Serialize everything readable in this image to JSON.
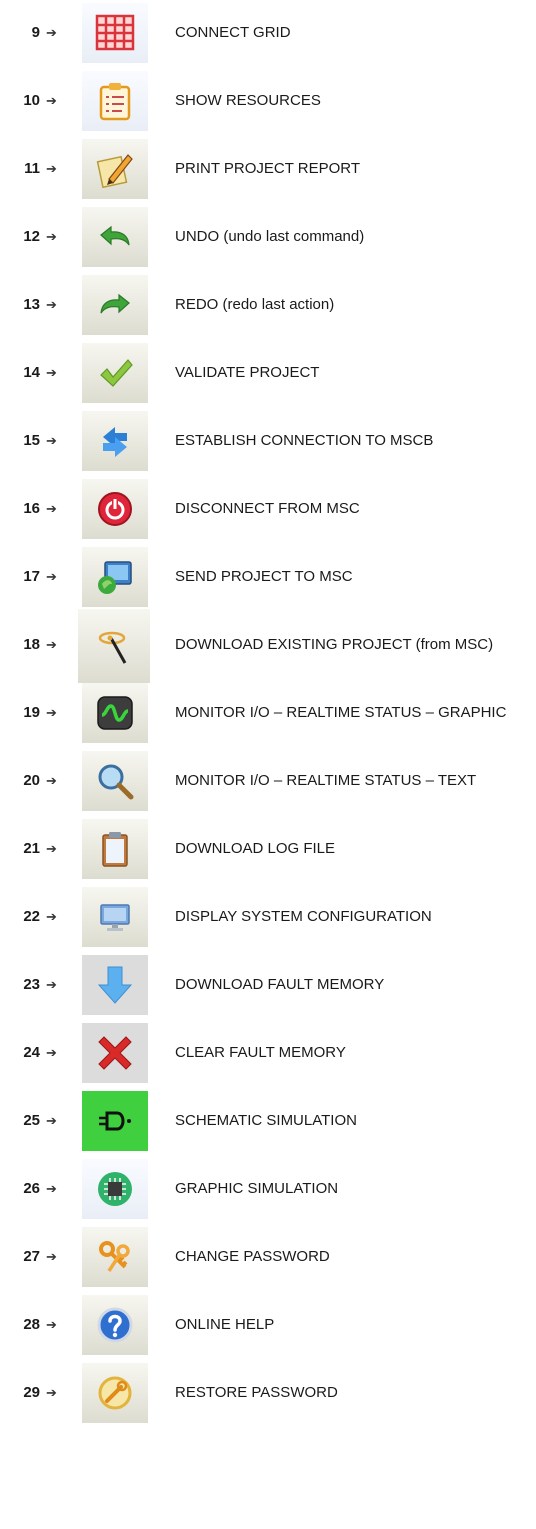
{
  "arrow_glyph": "➔",
  "items": [
    {
      "number": "9",
      "label": "CONNECT GRID",
      "icon": "grid-icon"
    },
    {
      "number": "10",
      "label": "SHOW RESOURCES",
      "icon": "resources-clipboard-icon"
    },
    {
      "number": "11",
      "label": "PRINT PROJECT REPORT",
      "icon": "report-pencil-icon"
    },
    {
      "number": "12",
      "label": "UNDO (undo last command)",
      "icon": "undo-arrow-icon"
    },
    {
      "number": "13",
      "label": "REDO (redo last action)",
      "icon": "redo-arrow-icon"
    },
    {
      "number": "14",
      "label": "VALIDATE PROJECT",
      "icon": "checkmark-icon"
    },
    {
      "number": "15",
      "label": "ESTABLISH CONNECTION TO MSCB",
      "icon": "connect-arrows-icon"
    },
    {
      "number": "16",
      "label": "DISCONNECT FROM MSC",
      "icon": "power-off-icon"
    },
    {
      "number": "17",
      "label": "SEND PROJECT TO MSC",
      "icon": "send-monitor-icon"
    },
    {
      "number": "18",
      "label": "DOWNLOAD EXISTING PROJECT (from MSC)",
      "icon": "magic-wand-icon"
    },
    {
      "number": "19",
      "label": "MONITOR I/O – REALTIME STATUS – GRAPHIC",
      "icon": "waveform-monitor-icon"
    },
    {
      "number": "20",
      "label": "MONITOR I/O – REALTIME STATUS – TEXT",
      "icon": "magnifier-icon"
    },
    {
      "number": "21",
      "label": "DOWNLOAD LOG FILE",
      "icon": "clipboard-icon"
    },
    {
      "number": "22",
      "label": "DISPLAY SYSTEM CONFIGURATION",
      "icon": "computer-monitor-icon"
    },
    {
      "number": "23",
      "label": "DOWNLOAD FAULT MEMORY",
      "icon": "down-arrow-icon"
    },
    {
      "number": "24",
      "label": "CLEAR FAULT MEMORY",
      "icon": "red-x-icon"
    },
    {
      "number": "25",
      "label": "SCHEMATIC SIMULATION",
      "icon": "schematic-gate-icon"
    },
    {
      "number": "26",
      "label": "GRAPHIC SIMULATION",
      "icon": "chip-icon"
    },
    {
      "number": "27",
      "label": "CHANGE PASSWORD",
      "icon": "keys-icon"
    },
    {
      "number": "28",
      "label": "ONLINE HELP",
      "icon": "help-question-icon"
    },
    {
      "number": "29",
      "label": "RESTORE PASSWORD",
      "icon": "restore-password-icon"
    }
  ]
}
